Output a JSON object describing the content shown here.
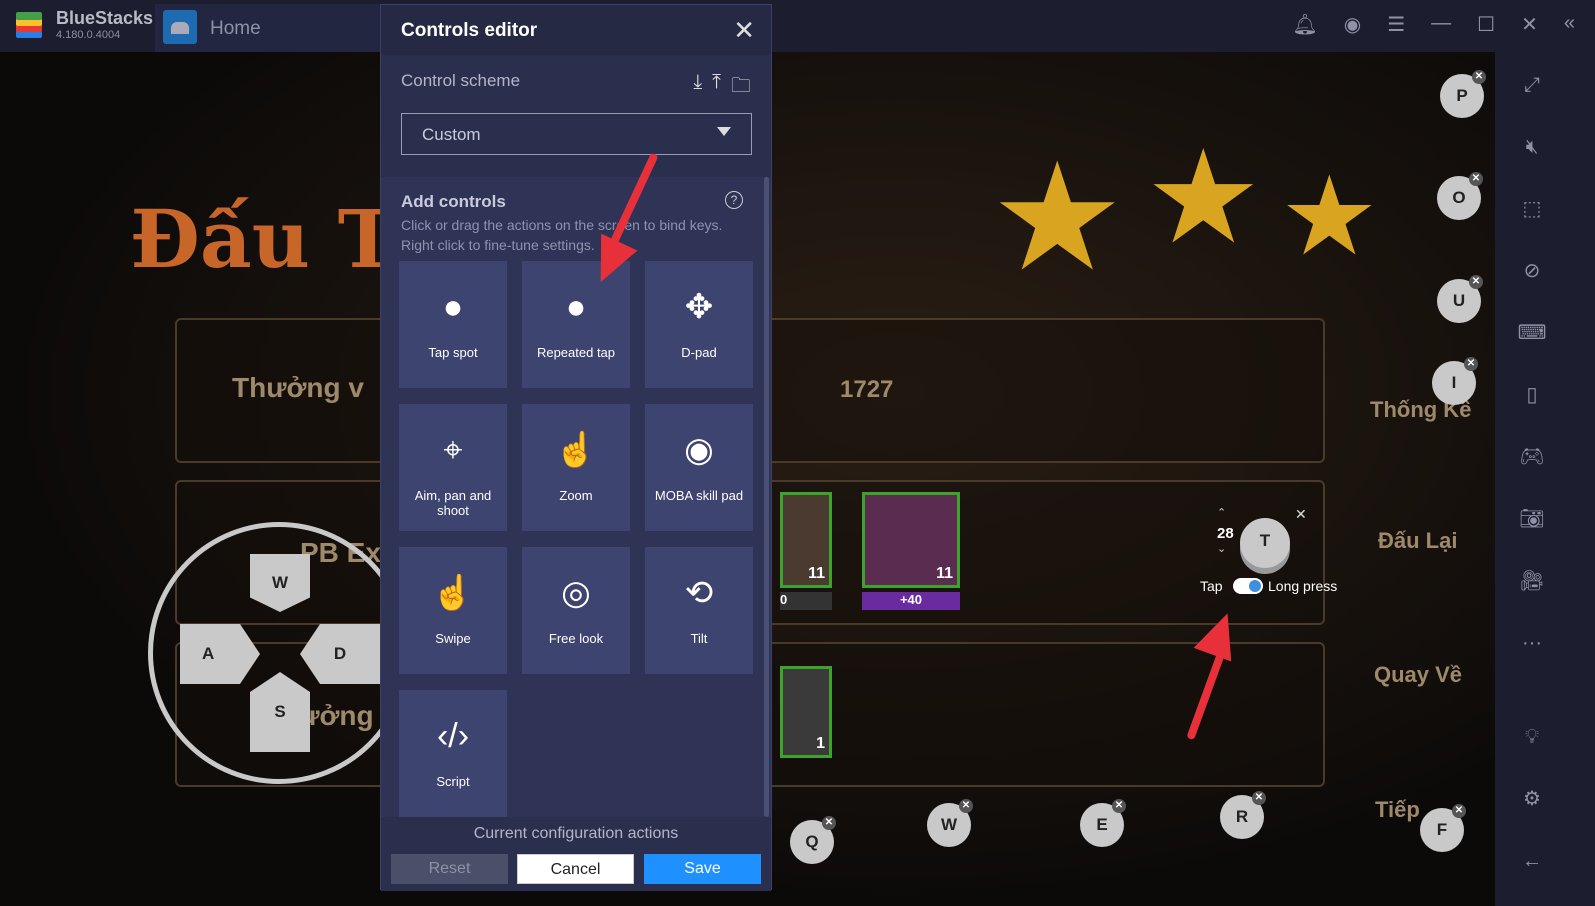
{
  "app": {
    "name": "BlueStacks",
    "version": "4.180.0.4004",
    "tab": "Home"
  },
  "game": {
    "labels": [
      "Thưởng v",
      "1727",
      "PB Ex",
      "Thưởng"
    ],
    "side_labels": [
      "Thống Kê",
      "Đấu Lại",
      "Quay Về",
      "Tiếp"
    ],
    "title": "Đấu T",
    "badges": [
      "11",
      "11",
      "+40",
      "1",
      "0"
    ]
  },
  "keys": [
    "P",
    "O",
    "U",
    "I",
    "Q",
    "W",
    "E",
    "R",
    "F"
  ],
  "dpad": {
    "up": "W",
    "left": "A",
    "right": "D",
    "down": "S"
  },
  "repeated_tap": {
    "key": "T",
    "count": "28",
    "mode_left": "Tap",
    "mode_right": "Long press",
    "long_press_enabled": true
  },
  "editor": {
    "title": "Controls editor",
    "scheme_label": "Control scheme",
    "scheme_value": "Custom",
    "add_title": "Add controls",
    "add_desc": "Click or drag the actions on the screen to bind keys. Right click to fine-tune settings.",
    "tiles": [
      {
        "label": "Tap spot",
        "icon": "circle-icon"
      },
      {
        "label": "Repeated tap",
        "icon": "stacked-circle-icon"
      },
      {
        "label": "D-pad",
        "icon": "dpad-icon"
      },
      {
        "label": "Aim, pan and shoot",
        "icon": "crosshair-icon"
      },
      {
        "label": "Zoom",
        "icon": "pinch-icon"
      },
      {
        "label": "MOBA skill pad",
        "icon": "ring-icon"
      },
      {
        "label": "Swipe",
        "icon": "swipe-icon"
      },
      {
        "label": "Free look",
        "icon": "eye-icon"
      },
      {
        "label": "Tilt",
        "icon": "tilt-icon"
      },
      {
        "label": "Script",
        "icon": "code-icon"
      }
    ],
    "current_config": "Current configuration actions",
    "reset": "Reset",
    "cancel": "Cancel",
    "save": "Save"
  },
  "colors": {
    "accent": "#1e90ff",
    "arrow": "#e8303a",
    "panel": "#2b2f4e"
  }
}
